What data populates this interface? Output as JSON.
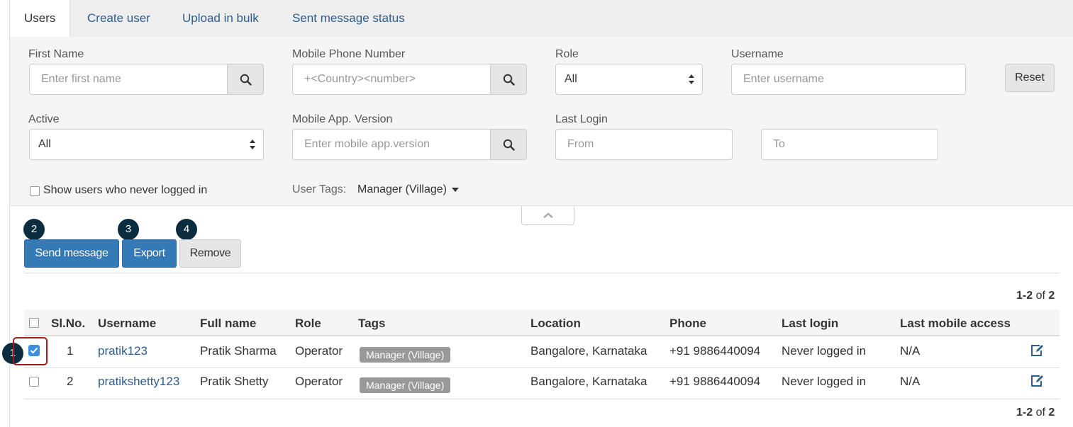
{
  "tabs": [
    {
      "label": "Users",
      "active": true
    },
    {
      "label": "Create user"
    },
    {
      "label": "Upload in bulk"
    },
    {
      "label": "Sent message status"
    }
  ],
  "filters": {
    "first_name": {
      "label": "First Name",
      "placeholder": "Enter first name"
    },
    "mobile": {
      "label": "Mobile Phone Number",
      "placeholder": "+<Country><number>"
    },
    "role": {
      "label": "Role",
      "value": "All"
    },
    "username": {
      "label": "Username",
      "placeholder": "Enter username"
    },
    "reset_label": "Reset",
    "active": {
      "label": "Active",
      "value": "All"
    },
    "app_version": {
      "label": "Mobile App. Version",
      "placeholder": "Enter mobile app.version"
    },
    "last_login": {
      "label": "Last Login",
      "from_placeholder": "From",
      "to_placeholder": "To"
    },
    "never_logged_label": "Show users who never logged in",
    "user_tags_label": "User Tags:",
    "user_tags_value": "Manager (Village)"
  },
  "callouts": [
    "1",
    "2",
    "3",
    "4"
  ],
  "actions": {
    "send_message": "Send message",
    "export": "Export",
    "remove": "Remove"
  },
  "pagination": {
    "range": "1-2",
    "of_label": "of",
    "total": "2"
  },
  "table": {
    "columns": [
      "Sl.No.",
      "Username",
      "Full name",
      "Role",
      "Tags",
      "Location",
      "Phone",
      "Last login",
      "Last mobile access"
    ],
    "rows": [
      {
        "checked": true,
        "slno": "1",
        "username": "pratik123",
        "full_name": "Pratik Sharma",
        "role": "Operator",
        "tag": "Manager (Village)",
        "location": "Bangalore, Karnataka",
        "phone": "+91 9886440094",
        "last_login": "Never logged in",
        "last_mobile_access": "N/A"
      },
      {
        "checked": false,
        "slno": "2",
        "username": "pratikshetty123",
        "full_name": "Pratik Shetty",
        "role": "Operator",
        "tag": "Manager (Village)",
        "location": "Bangalore, Karnataka",
        "phone": "+91 9886440094",
        "last_login": "Never logged in",
        "last_mobile_access": "N/A"
      }
    ]
  },
  "colors": {
    "primary": "#337ab7",
    "link": "#2c5d8e",
    "callout": "#0c2d40",
    "highlight": "#a21a1a",
    "tag": "#999999"
  },
  "icons": [
    "search-icon",
    "select-arrows-icon",
    "caret-down-icon",
    "chevron-up-icon",
    "checkmark-icon",
    "edit-icon"
  ]
}
